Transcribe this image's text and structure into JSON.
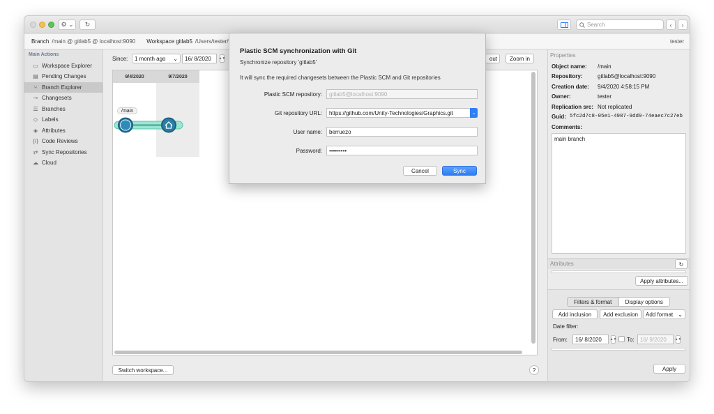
{
  "toolbar": {
    "search_placeholder": "Search",
    "gear_label": "⚙ ⌄",
    "refresh_label": "↻"
  },
  "infobar": {
    "branch_label": "Branch",
    "branch_value": "/main @ gitlab5 @ localhost:9090",
    "workspace_label": "Workspace gitlab5",
    "workspace_path": "/Users/tester/w",
    "user": "tester"
  },
  "sidebar": {
    "header": "Main Actions",
    "items": [
      {
        "label": "Workspace Explorer",
        "icon": "folder-icon"
      },
      {
        "label": "Pending Changes",
        "icon": "pending-changes-icon"
      },
      {
        "label": "Branch Explorer",
        "icon": "branch-icon"
      },
      {
        "label": "Changesets",
        "icon": "changeset-icon"
      },
      {
        "label": "Branches",
        "icon": "branches-list-icon"
      },
      {
        "label": "Labels",
        "icon": "label-icon"
      },
      {
        "label": "Attributes",
        "icon": "attribute-icon"
      },
      {
        "label": "Code Reviews",
        "icon": "code-review-icon"
      },
      {
        "label": "Sync Repositories",
        "icon": "sync-icon"
      },
      {
        "label": "Cloud",
        "icon": "cloud-icon"
      }
    ]
  },
  "main": {
    "since_label": "Since:",
    "since_value": "1 month ago",
    "date_value": "16/  8/2020",
    "zoom_out_label": "out",
    "zoom_in_label": "Zoom in",
    "columns": [
      "9/4/2020",
      "9/7/2020"
    ],
    "branch_tag": "/main",
    "switch_workspace_label": "Switch workspace...",
    "help_label": "?"
  },
  "properties": {
    "title": "Properties",
    "rows": [
      {
        "key": "Object name:",
        "value": "/main"
      },
      {
        "key": "Repository:",
        "value": "gitlab5@localhost:9090"
      },
      {
        "key": "Creation date:",
        "value": "9/4/2020 4:58:15 PM"
      },
      {
        "key": "Owner:",
        "value": "tester"
      },
      {
        "key": "Replication src:",
        "value": "Not replicated"
      },
      {
        "key": "Guid:",
        "value": "5fc2d7c8-05e1-4987-9dd9-74eaec7c27eb"
      }
    ],
    "comments_label": "Comments:",
    "comments_value": "main branch"
  },
  "attributes": {
    "title": "Attributes",
    "apply_label": "Apply attributes..."
  },
  "filters": {
    "tab_filters": "Filters & format",
    "tab_display": "Display options",
    "add_inclusion": "Add inclusion",
    "add_exclusion": "Add exclusion",
    "add_format": "Add format",
    "date_filter_label": "Date filter:",
    "from_label": "From:",
    "from_value": "16/  8/2020",
    "to_label": "To:",
    "to_value": "16/  9/2020",
    "apply_label": "Apply"
  },
  "dialog": {
    "title": "Plastic SCM synchronization with Git",
    "subtitle": "Synchronize repository 'gitlab5'",
    "description": "It will sync the required changesets between the Plastic SCM and Git repositories",
    "fields": [
      {
        "label": "Plastic SCM repository:",
        "value": "gitlab5@localhost:9090"
      },
      {
        "label": "Git repository URL:",
        "value": "https://github.com/Unity-Technologies/Graphics.git"
      },
      {
        "label": "User name:",
        "value": "berruezo"
      },
      {
        "label": "Password:",
        "value": "•••••••••"
      }
    ],
    "cancel_label": "Cancel",
    "sync_label": "Sync"
  },
  "colors": {
    "accent": "#2d7cf4",
    "branch_line": "#7fdcc5",
    "changeset_node": "#2b7fa6"
  }
}
